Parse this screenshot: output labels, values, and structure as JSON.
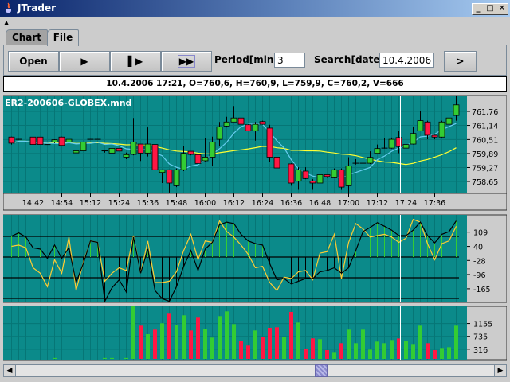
{
  "window": {
    "title": "JTrader"
  },
  "tabs": [
    {
      "label": "Chart"
    },
    {
      "label": "File"
    }
  ],
  "toolbar": {
    "open_label": "Open",
    "period_label": "Period[min]:",
    "period_value": "3",
    "search_label": "Search[date]:",
    "search_value": "10.4.2006",
    "go_label": ">"
  },
  "info_bar": "10.4.2006 17:21, O=760,6, H=760,9, L=759,9, C=760,2, V=666",
  "colors": {
    "panel": "#0b8a8a",
    "grid": "#067676",
    "up": "#33cc33",
    "down": "#ff1744",
    "ma_fast": "#66ccee",
    "ma_slow": "#ffff33",
    "osc_line2": "#ffcc33"
  },
  "chart_data": {
    "type": "candlestick",
    "title": "ER2-200606-GLOBEX.mnd",
    "time_labels": [
      "14:42",
      "14:54",
      "15:12",
      "15:24",
      "15:36",
      "15:48",
      "16:00",
      "16:12",
      "16:24",
      "16:36",
      "16:48",
      "17:00",
      "17:12",
      "17:24",
      "17:36"
    ],
    "price_ticks": [
      "761,76",
      "761,14",
      "760,51",
      "759,89",
      "759,27",
      "758,65"
    ],
    "cursor_index": 54,
    "candles": [
      [
        760.62,
        760.64,
        760.29,
        760.35
      ],
      [
        760.52,
        760.54,
        760.5,
        760.52
      ],
      null,
      [
        760.62,
        760.64,
        760.29,
        760.29
      ],
      [
        760.62,
        760.62,
        760.29,
        760.29
      ],
      [
        760.29,
        760.3,
        760.28,
        760.29
      ],
      [
        760.4,
        760.52,
        760.35,
        760.5
      ],
      [
        760.62,
        760.64,
        760.25,
        760.25
      ],
      [
        760.4,
        760.52,
        760.4,
        760.52
      ],
      [
        759.92,
        760.01,
        759.92,
        760.01
      ],
      [
        760.01,
        760.4,
        760.01,
        760.4
      ],
      [
        760.52,
        760.53,
        760.51,
        760.52
      ],
      [
        760.52,
        760.53,
        760.51,
        760.52
      ],
      [
        760.01,
        760.01,
        759.93,
        760.01
      ],
      [
        759.91,
        760.12,
        759.87,
        760.12
      ],
      [
        760.12,
        760.12,
        760.0,
        760.0
      ],
      [
        759.73,
        759.93,
        759.64,
        759.84
      ],
      [
        759.85,
        761.47,
        759.81,
        760.4
      ],
      [
        760.31,
        760.31,
        759.56,
        759.91
      ],
      [
        759.91,
        761.05,
        759.76,
        760.31
      ],
      [
        760.29,
        760.35,
        759.11,
        759.17
      ],
      [
        759.05,
        759.17,
        758.58,
        759.17
      ],
      [
        759.17,
        759.17,
        758.16,
        758.58
      ],
      [
        758.46,
        759.23,
        758.4,
        759.17
      ],
      [
        759.17,
        760.23,
        759.11,
        759.9
      ],
      [
        759.99,
        759.99,
        759.81,
        759.85
      ],
      [
        759.84,
        759.84,
        758.36,
        759.45
      ],
      [
        759.57,
        760.58,
        759.54,
        759.73
      ],
      [
        759.73,
        760.64,
        759.34,
        760.4
      ],
      [
        760.52,
        761.29,
        760.23,
        761.08
      ],
      [
        761.11,
        761.52,
        761.05,
        761.29
      ],
      [
        761.29,
        762.0,
        761.29,
        761.47
      ],
      [
        761.47,
        761.7,
        761.17,
        761.19
      ],
      [
        761.17,
        761.19,
        760.88,
        760.9
      ],
      [
        760.9,
        761.29,
        760.46,
        761.19
      ],
      [
        761.31,
        761.35,
        761.17,
        761.19
      ],
      [
        761.02,
        761.17,
        759.52,
        759.73
      ],
      [
        759.73,
        759.73,
        758.95,
        759.25
      ],
      [
        759.34,
        759.36,
        759.32,
        759.34
      ],
      [
        759.43,
        759.46,
        758.46,
        758.58
      ],
      [
        758.67,
        759.28,
        758.28,
        759.17
      ],
      [
        759.11,
        759.28,
        758.75,
        758.78
      ],
      [
        758.67,
        758.75,
        758.28,
        758.58
      ],
      [
        758.58,
        759.46,
        758.52,
        758.95
      ],
      [
        758.95,
        758.95,
        758.81,
        758.87
      ],
      [
        758.81,
        759.23,
        758.79,
        759.17
      ],
      [
        759.17,
        759.23,
        758.28,
        758.4
      ],
      [
        758.46,
        759.73,
        758.13,
        759.34
      ],
      [
        759.46,
        759.64,
        759.4,
        759.46
      ],
      [
        759.46,
        760.17,
        759.43,
        759.46
      ],
      [
        759.46,
        759.99,
        759.43,
        759.72
      ],
      [
        759.9,
        760.29,
        759.87,
        760.11
      ],
      [
        760.13,
        760.58,
        760.11,
        760.13
      ],
      [
        760.13,
        760.6,
        760.11,
        760.52
      ],
      [
        760.6,
        760.9,
        759.9,
        760.2
      ],
      [
        760.13,
        760.35,
        760.11,
        760.29
      ],
      [
        760.31,
        761.08,
        760.29,
        760.78
      ],
      [
        760.9,
        761.76,
        760.88,
        761.35
      ],
      [
        761.29,
        761.35,
        760.52,
        760.7
      ],
      [
        760.7,
        760.72,
        760.52,
        760.62
      ],
      [
        760.62,
        761.35,
        760.6,
        761.29
      ],
      [
        761.19,
        761.52,
        761.15,
        761.47
      ],
      [
        761.58,
        762.47,
        761.35,
        762.05
      ]
    ],
    "volume": [
      0,
      0,
      0,
      0,
      0,
      0,
      30,
      0,
      0,
      0,
      0,
      0,
      0,
      30,
      30,
      0,
      30,
      1716,
      1084,
      806,
      954,
      1162,
      1500,
      1110,
      1422,
      928,
      1370,
      980,
      694,
      1396,
      1552,
      1136,
      598,
      434,
      928,
      711,
      1014,
      1032,
      720,
      1535,
      1188,
      338,
      668,
      642,
      286,
      225,
      512,
      954,
      512,
      954,
      303,
      564,
      512,
      616,
      666,
      590,
      486,
      1084,
      512,
      286,
      355,
      381,
      1084
    ],
    "volume_ticks": [
      "1155",
      "735",
      "316"
    ],
    "oscillator": {
      "levels": [
        100,
        0,
        -100,
        -200
      ],
      "ticks": [
        "109",
        "40",
        "-28",
        "-96",
        "-165"
      ],
      "line1": [
        101,
        117,
        97,
        45,
        39,
        -6,
        58,
        -6,
        45,
        -123,
        -32,
        78,
        71,
        -214,
        -149,
        -110,
        -169,
        97,
        -78,
        39,
        -162,
        -201,
        -214,
        -143,
        -45,
        32,
        -65,
        39,
        71,
        156,
        169,
        162,
        110,
        78,
        65,
        58,
        -32,
        -110,
        -104,
        -130,
        -117,
        -104,
        -104,
        -71,
        -65,
        -52,
        -78,
        -52,
        32,
        123,
        143,
        166,
        149,
        130,
        104,
        104,
        130,
        169,
        104,
        69,
        110,
        123,
        175
      ],
      "line2": [
        52,
        58,
        45,
        -52,
        -78,
        -143,
        -13,
        -78,
        97,
        -162,
        -26,
        78,
        71,
        -117,
        -78,
        -52,
        -65,
        104,
        -78,
        78,
        -123,
        -123,
        -117,
        -71,
        32,
        110,
        -13,
        78,
        71,
        175,
        123,
        97,
        58,
        13,
        -52,
        -45,
        -123,
        -162,
        -97,
        -104,
        -71,
        -65,
        -110,
        19,
        26,
        110,
        -104,
        71,
        162,
        136,
        97,
        104,
        110,
        97,
        71,
        91,
        182,
        169,
        65,
        -13,
        65,
        78,
        149
      ]
    }
  }
}
